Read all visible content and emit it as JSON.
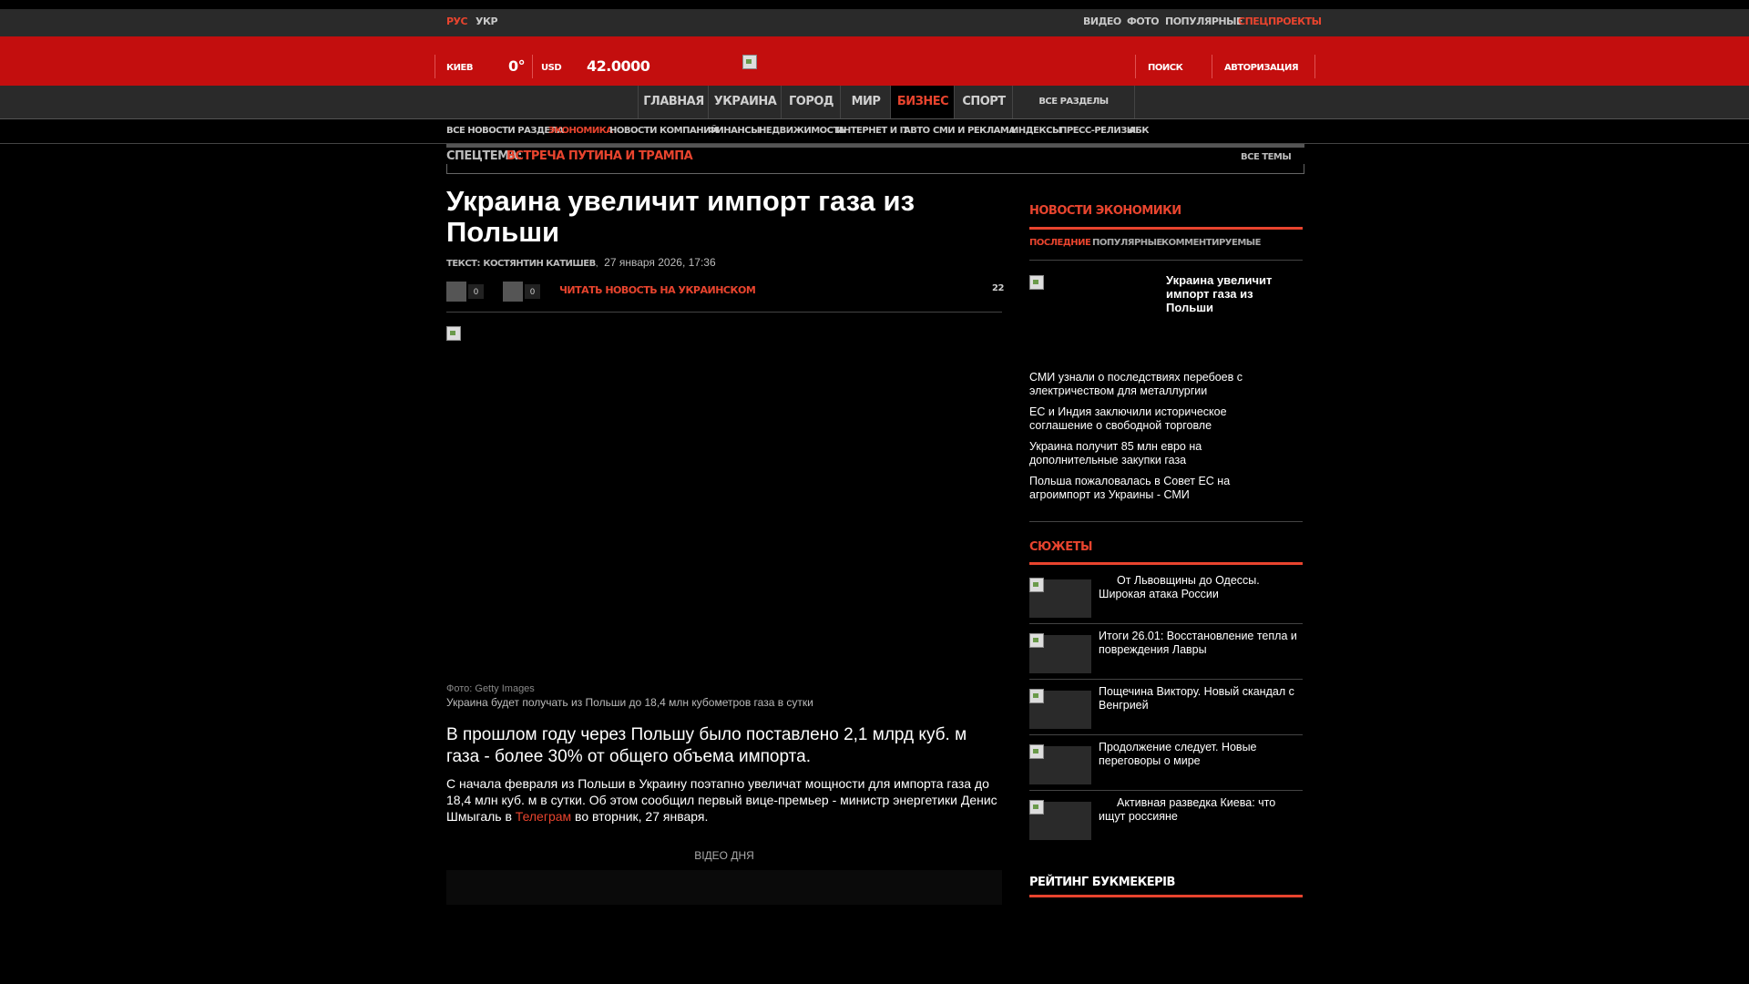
{
  "topbar": {
    "lang_ru": "РУС",
    "lang_ua": "УКР",
    "links": [
      "ВИДЕО",
      "ФОТО",
      "ПОПУЛЯРНЫЕ",
      "СПЕЦПРОЕКТЫ"
    ]
  },
  "header": {
    "city": "КИЕВ",
    "temperature": "0°",
    "currency": "USD",
    "rate": "42.0000",
    "search": "ПОИСК",
    "login": "АВТОРИЗАЦИЯ"
  },
  "mainnav": {
    "tabs": [
      "ГЛАВНАЯ",
      "УКРАИНА",
      "ГОРОД",
      "МИР",
      "БИЗНЕС",
      "СПОРТ"
    ],
    "all_sections": "ВСЕ РАЗДЕЛЫ",
    "active_index": 4
  },
  "subnav": {
    "items": [
      "ВСЕ НОВОСТИ РАЗДЕЛА",
      "ЭКОНОМИКА",
      "НОВОСТИ КОМПАНИЙ",
      "ФИНАНСЫ",
      "НЕДВИЖИМОСТЬ",
      "ИНТЕРНЕТ И IT",
      "АВТО",
      "СМИ И РЕКЛАМА",
      "ИНДЕКСЫ",
      "ПРЕСС-РЕЛИЗЫ",
      "АБК"
    ],
    "active_index": 1
  },
  "spectema": {
    "label": "СПЕЦТЕМА:",
    "topic": "ВСТРЕЧА ПУТИНА И ТРАМПА",
    "all_topics": "ВСЕ ТЕМЫ"
  },
  "article": {
    "title": "Украина увеличит импорт газа из Польши",
    "author_prefix": "ТЕКСТ:",
    "author": "КОСТЯНТИН КАТИШЕВ",
    "date": "27 января 2026, 17:36",
    "likes": "0",
    "dislikes": "0",
    "read_ua": "ЧИТАТЬ НОВОСТЬ НА УКРАИНСКОМ",
    "comments": "22",
    "photo_credit": "Фото: Getty Images",
    "photo_caption": "Украина будет получать из Польши до 18,4 млн кубометров газа в сутки",
    "lead": "В прошлом году через Польшу было поставлено 2,1 млрд куб. м газа - более 30% от общего объема импорта.",
    "body_part1": "С начала февраля из Польши в Украину поэтапно увеличат мощности для импорта газа до 18,4 млн куб. м в сутки. Об этом сообщил первый вице-премьер - министр энергетики Денис Шмыгаль в ",
    "body_link": "Телеграм",
    "body_part2": " во вторник, 27 января.",
    "video_label": "ВІДЕО ДНЯ"
  },
  "sidebar": {
    "econ_title": "НОВОСТИ ЭКОНОМИКИ",
    "tabs": [
      "ПОСЛЕДНИЕ",
      "ПОПУЛЯРНЫЕ",
      "КОММЕНТИРУЕМЫЕ"
    ],
    "featured": "Украина увеличит импорт газа из Польши",
    "news": [
      "СМИ узнали о последствиях перебоев с электричеством для металлургии",
      "ЕС и Индия заключили историческое соглашение о свободной торговле",
      "Украина получит 85 млн евро на дополнительные закупки газа",
      "Польша пожаловалась в Совет ЕС на агроимпорт из Украины - СМИ"
    ],
    "stories_title": "СЮЖЕТЫ",
    "stories": [
      "От Львовщины до Одессы. Широкая атака России",
      "Итоги 26.01: Восстановление тепла и повреждения Лавры",
      "Пощечина Виктору. Новый скандал с Венгрией",
      "Продолжение следует. Новые переговоры о мире",
      "Активная разведка Киева: что ищут россияне"
    ],
    "bookmakers_title": "РЕЙТИНГ БУКМЕКЕРІВ"
  }
}
